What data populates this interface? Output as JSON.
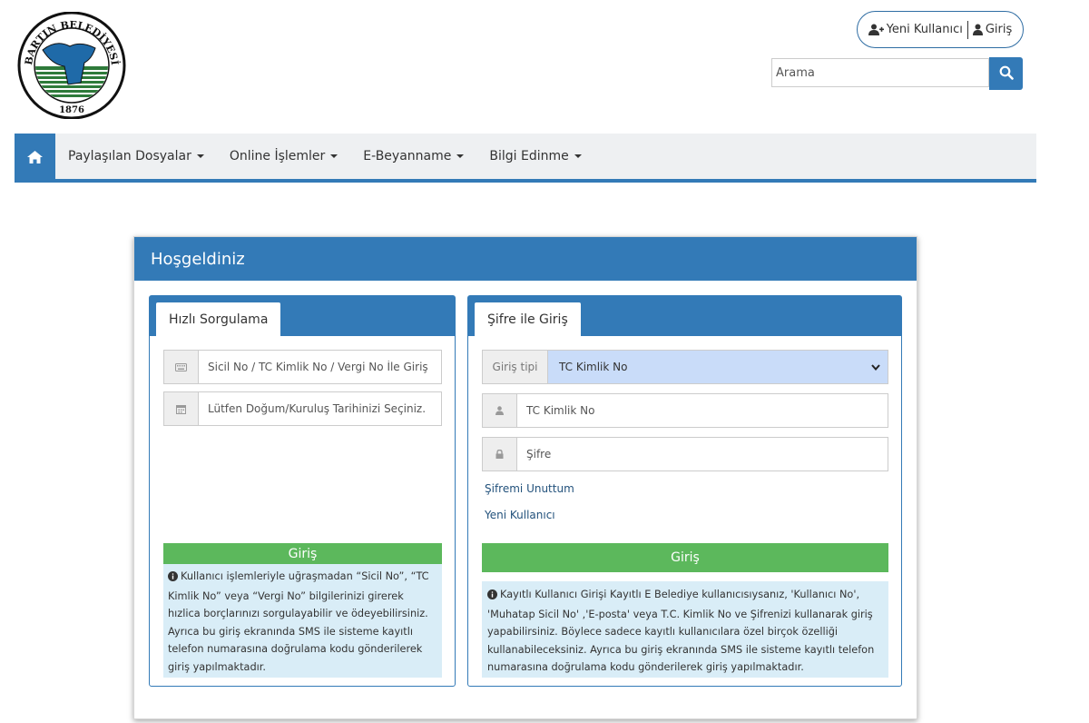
{
  "logo": {
    "top_text": "BARTIN BELEDİYESİ",
    "year": "1876"
  },
  "auth": {
    "new_user": "Yeni Kullanıcı",
    "login": "Giriş"
  },
  "search": {
    "placeholder": "Arama",
    "value": "Arama"
  },
  "nav": {
    "items": [
      {
        "label": "Paylaşılan Dosyalar"
      },
      {
        "label": "Online İşlemler"
      },
      {
        "label": "E-Beyanname"
      },
      {
        "label": "Bilgi Edinme"
      }
    ]
  },
  "panel": {
    "title": "Hoşgeldiniz"
  },
  "quick": {
    "tab": "Hızlı Sorgulama",
    "id_placeholder": "Sicil No / TC Kimlik No / Vergi No İle Giriş",
    "date_placeholder": "Lütfen Doğum/Kuruluş Tarihinizi Seçiniz.",
    "button": "Giriş",
    "info": "Kullanıcı işlemleriyle uğraşmadan “Sicil No”, “TC Kimlik No” veya “Vergi No” bilgilerinizi girerek hızlica borçlarınızı sorgulayabilir ve ödeyebilirsiniz. Ayrıca bu giriş ekranında SMS ile sisteme kayıtlı telefon numarasına doğrulama kodu gönderilerek giriş yapılmaktadır."
  },
  "password": {
    "tab": "Şifre ile Giriş",
    "type_label": "Giriş tipi",
    "type_value": "TC Kimlik No",
    "user_placeholder": "TC Kimlik No",
    "pass_placeholder": "Şifre",
    "forgot": "Şifremi Unuttum",
    "new_user": "Yeni Kullanıcı",
    "button": "Giriş",
    "info": "Kayıtlı Kullanıcı Girişi Kayıtlı E Belediye kullanıcısıysanız, 'Kullanıcı No', 'Muhatap Sicil No' ,'E-posta' veya T.C. Kimlik No ve Şifrenizi kullanarak giriş yapabilirsiniz. Böylece sadece kayıtlı kullanıcılara özel birçok özelliği kullanabileceksiniz. Ayrıca bu giriş ekranında SMS ile sisteme kayıtlı telefon numarasına doğrulama kodu gönderilerek giriş yapılmaktadır."
  },
  "colors": {
    "primary": "#337ab7",
    "success": "#5cb85c",
    "info_bg": "#d9edf7",
    "select_bg": "#c9dcf9",
    "nav_bg": "#eef0f2"
  }
}
